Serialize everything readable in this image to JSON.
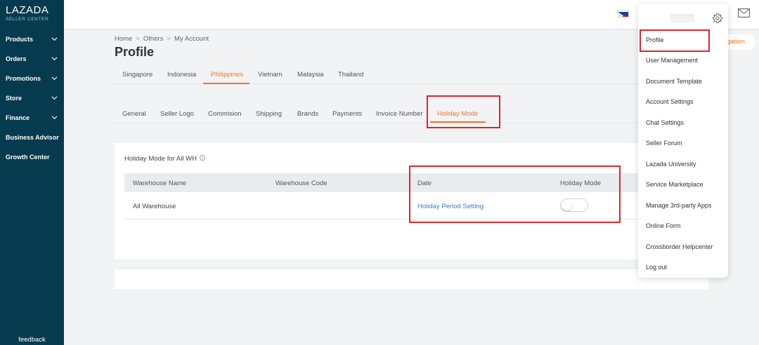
{
  "brand": {
    "name": "LAZADA",
    "sub": "SELLER CENTER"
  },
  "sidebar": {
    "items": [
      {
        "label": "Products",
        "has_chevron": true
      },
      {
        "label": "Orders",
        "has_chevron": true
      },
      {
        "label": "Promotions",
        "has_chevron": true
      },
      {
        "label": "Store",
        "has_chevron": true
      },
      {
        "label": "Finance",
        "has_chevron": true
      },
      {
        "label": "Business Advisor",
        "has_chevron": false
      },
      {
        "label": "Growth Center",
        "has_chevron": false
      }
    ],
    "feedback": "feedback"
  },
  "topbar": {
    "flag_icon": "philippines-flag-icon",
    "mail_icon": "mail-icon"
  },
  "breadcrumb": [
    "Home",
    "Others",
    "My Account"
  ],
  "page_title": "Profile",
  "country_tabs": [
    "Singapore",
    "Indonesia",
    "Philippines",
    "Vietnam",
    "Malaysia",
    "Thailand"
  ],
  "country_tabs_active": "Philippines",
  "setting_tabs": [
    "General",
    "Seller Logo",
    "Commision",
    "Shipping",
    "Brands",
    "Payments",
    "Invoice Number",
    "Holiday Mode"
  ],
  "setting_tabs_active": "Holiday Mode",
  "holiday": {
    "title": "Holiday Mode for All WH",
    "columns": [
      "Warehouse Name",
      "Warehouse Code",
      "Date",
      "Holiday Mode"
    ],
    "rows": [
      {
        "warehouse_name": "All Warehouse",
        "warehouse_code": "",
        "date_link": "Holiday Period Setting",
        "holiday_mode_on": false
      }
    ]
  },
  "navigation_pill": "gation",
  "dropdown": {
    "items": [
      "Profile",
      "User Management",
      "Document Template",
      "Account Settings",
      "Chat Settings",
      "Seller Forum",
      "Lazada University",
      "Service Marketplace",
      "Manage 3rd-party Apps",
      "Online Form",
      "Crossborder Helpcenter",
      "Log out"
    ]
  },
  "colors": {
    "sidebar_bg": "#063a4f",
    "accent": "#f57224",
    "link": "#3a7bd5",
    "annotation": "#e0242a"
  }
}
